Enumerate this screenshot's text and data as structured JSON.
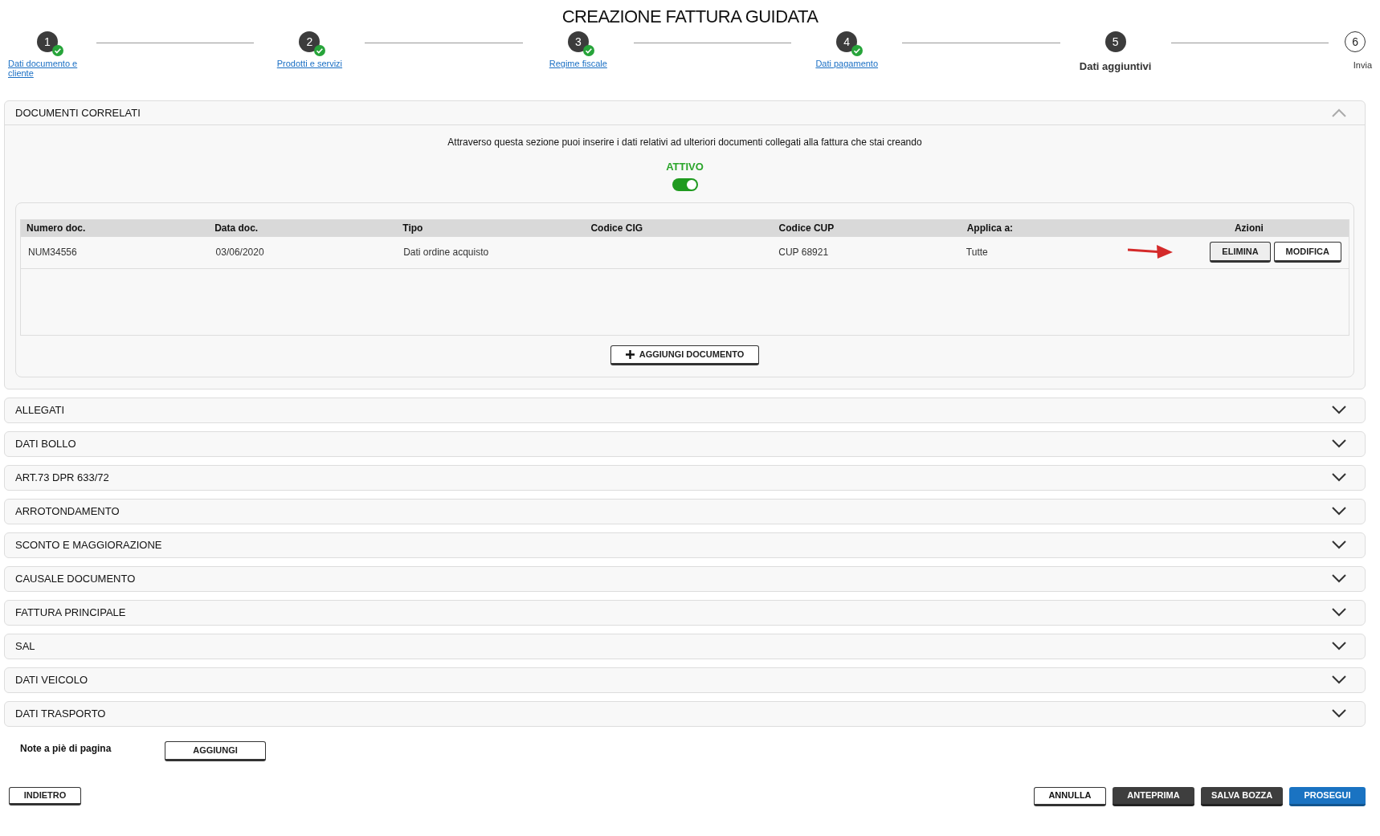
{
  "title": "CREAZIONE FATTURA GUIDATA",
  "steps": [
    {
      "number": "1",
      "label": "Dati documento e cliente",
      "completed": true,
      "current": false
    },
    {
      "number": "2",
      "label": "Prodotti e servizi",
      "completed": true,
      "current": false
    },
    {
      "number": "3",
      "label": "Regime fiscale",
      "completed": true,
      "current": false
    },
    {
      "number": "4",
      "label": "Dati pagamento",
      "completed": true,
      "current": false
    },
    {
      "number": "5",
      "label": "Dati aggiuntivi",
      "completed": false,
      "current": true
    },
    {
      "number": "6",
      "label": "Invia",
      "completed": false,
      "current": false
    }
  ],
  "sections": [
    {
      "title": "DOCUMENTI CORRELATI",
      "expanded": true,
      "description": "Attraverso questa sezione puoi inserire i dati relativi ad ulteriori documenti collegati alla fattura che stai creando",
      "toggle": {
        "label": "ATTIVO",
        "on": true
      },
      "table": {
        "columns": [
          "Numero doc.",
          "Data doc.",
          "Tipo",
          "Codice CIG",
          "Codice CUP",
          "Applica a:",
          "Azioni"
        ],
        "rows": [
          {
            "cells": [
              "NUM34556",
              "03/06/2020",
              "Dati ordine acquisto",
              "",
              "CUP 68921",
              "Tutte"
            ],
            "actions": [
              "ELIMINA",
              "MODIFICA"
            ]
          }
        ]
      },
      "add_button": "AGGIUNGI DOCUMENTO"
    },
    {
      "title": "ALLEGATI",
      "expanded": false
    },
    {
      "title": "DATI BOLLO",
      "expanded": false
    },
    {
      "title": "ART.73 DPR 633/72",
      "expanded": false
    },
    {
      "title": "ARROTONDAMENTO",
      "expanded": false
    },
    {
      "title": "SCONTO E MAGGIORAZIONE",
      "expanded": false
    },
    {
      "title": "CAUSALE DOCUMENTO",
      "expanded": false
    },
    {
      "title": "FATTURA PRINCIPALE",
      "expanded": false
    },
    {
      "title": "SAL",
      "expanded": false
    },
    {
      "title": "DATI VEICOLO",
      "expanded": false
    },
    {
      "title": "DATI TRASPORTO",
      "expanded": false
    }
  ],
  "footnotes": {
    "label": "Note a piè di pagina",
    "button": "AGGIUNGI"
  },
  "back_button": "INDIETRO",
  "actions": [
    {
      "label": "ANNULLA",
      "kind": "outline"
    },
    {
      "label": "ANTEPRIMA",
      "kind": "dark"
    },
    {
      "label": "SALVA BOZZA",
      "kind": "dark"
    },
    {
      "label": "PROSEGUI",
      "kind": "primary"
    }
  ]
}
